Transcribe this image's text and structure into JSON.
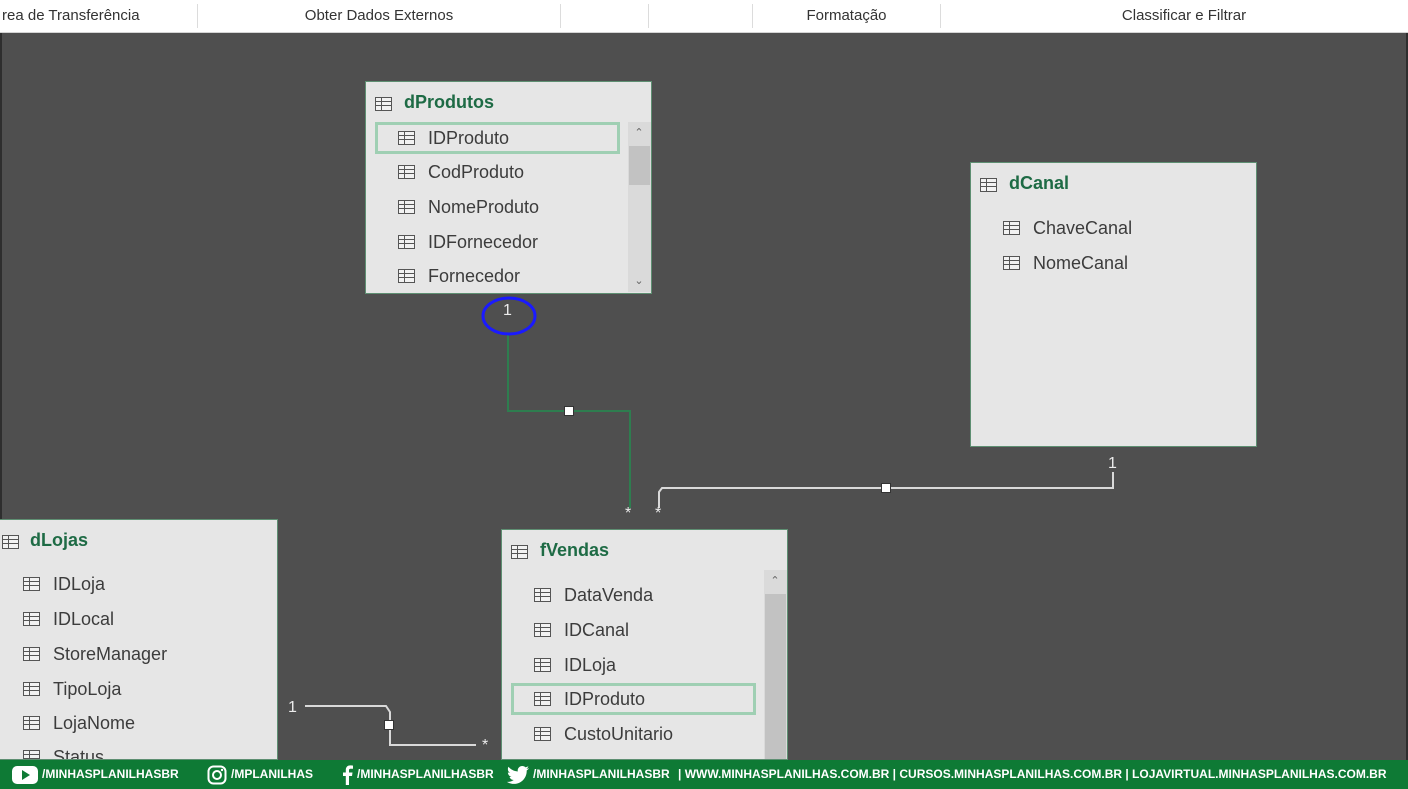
{
  "ribbon": {
    "groups": [
      "rea de Transferência",
      "Obter Dados Externos",
      "Formatação",
      "Classificar e Filtrar"
    ]
  },
  "tables": {
    "dProdutos": {
      "title": "dProdutos",
      "fields": [
        "IDProduto",
        "CodProduto",
        "NomeProduto",
        "IDFornecedor",
        "Fornecedor"
      ],
      "selected_field": "IDProduto"
    },
    "dCanal": {
      "title": "dCanal",
      "fields": [
        "ChaveCanal",
        "NomeCanal"
      ]
    },
    "dLojas": {
      "title": "dLojas",
      "fields": [
        "IDLoja",
        "IDLocal",
        "StoreManager",
        "TipoLoja",
        "LojaNome",
        "Status"
      ]
    },
    "fVendas": {
      "title": "fVendas",
      "fields": [
        "DataVenda",
        "IDCanal",
        "IDLoja",
        "IDProduto",
        "CustoUnitario"
      ],
      "selected_field": "IDProduto"
    }
  },
  "relationships": {
    "one": "1",
    "many": "*"
  },
  "footer": {
    "youtube": "/MINHASPLANILHASBR",
    "instagram": "/MPLANILHAS",
    "facebook": "/MINHASPLANILHASBR",
    "twitter": "/MINHASPLANILHASBR",
    "links": "|  WWW.MINHASPLANILHAS.COM.BR | CURSOS.MINHASPLANILHAS.COM.BR | LOJAVIRTUAL.MINHASPLANILHAS.COM.BR"
  },
  "colors": {
    "canvas": "#4f4f4f",
    "table_title": "#1e6b45",
    "active_relationship": "#2e7d4f",
    "annotation_circle": "#1a1aff",
    "footer": "#0e7a35"
  },
  "icons": [
    "table-icon",
    "youtube-icon",
    "instagram-icon",
    "facebook-icon",
    "twitter-icon",
    "scroll-up-icon",
    "scroll-down-icon"
  ]
}
